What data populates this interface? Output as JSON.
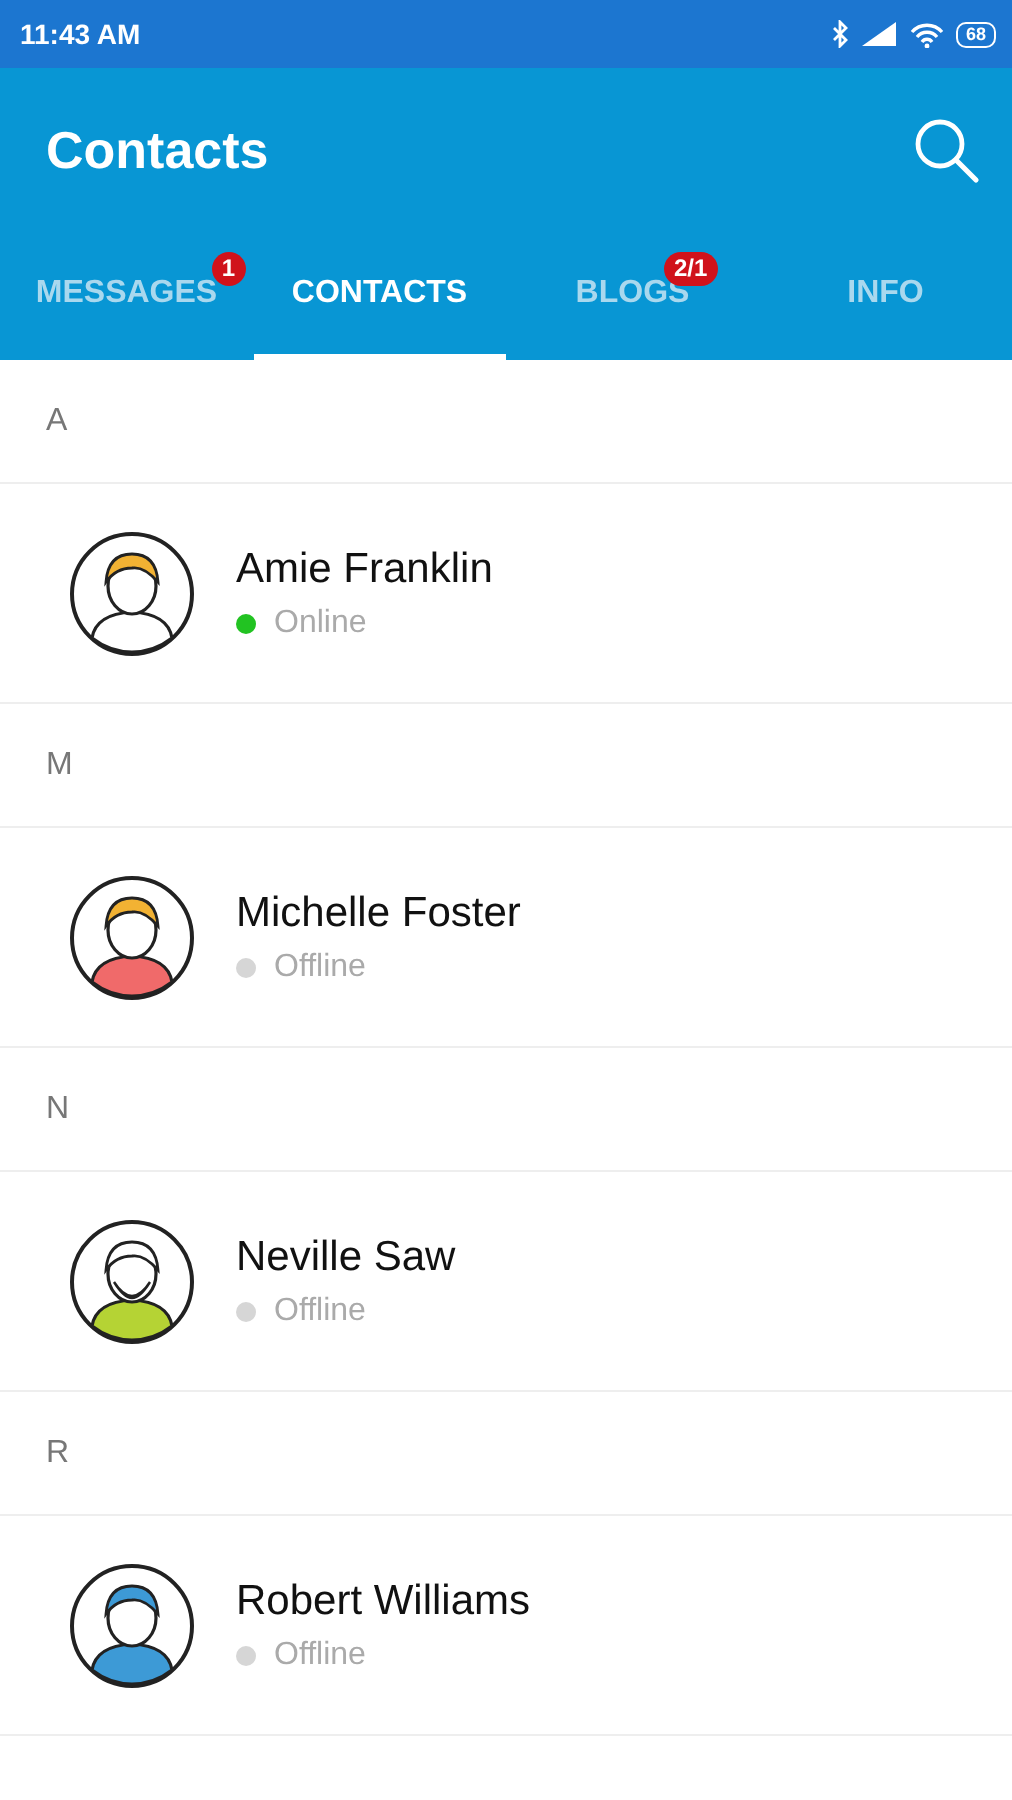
{
  "status_bar": {
    "time": "11:43 AM",
    "battery": "68"
  },
  "app_bar": {
    "title": "Contacts"
  },
  "tabs": [
    {
      "label": "MESSAGES",
      "selected": false,
      "badge": "1"
    },
    {
      "label": "CONTACTS",
      "selected": true
    },
    {
      "label": "BLOGS",
      "selected": false,
      "badge": "2/1"
    },
    {
      "label": "INFO",
      "selected": false
    }
  ],
  "sections": [
    {
      "letter": "A",
      "contacts": [
        {
          "name": "Amie Franklin",
          "status": "Online",
          "color": "#22c322"
        }
      ]
    },
    {
      "letter": "M",
      "contacts": [
        {
          "name": "Michelle Foster",
          "status": "Offline",
          "color": "#d6d6d6"
        }
      ]
    },
    {
      "letter": "N",
      "contacts": [
        {
          "name": "Neville Saw",
          "status": "Offline",
          "color": "#d6d6d6"
        }
      ]
    },
    {
      "letter": "R",
      "contacts": [
        {
          "name": "Robert Williams",
          "status": "Offline",
          "color": "#d6d6d6"
        }
      ]
    }
  ]
}
